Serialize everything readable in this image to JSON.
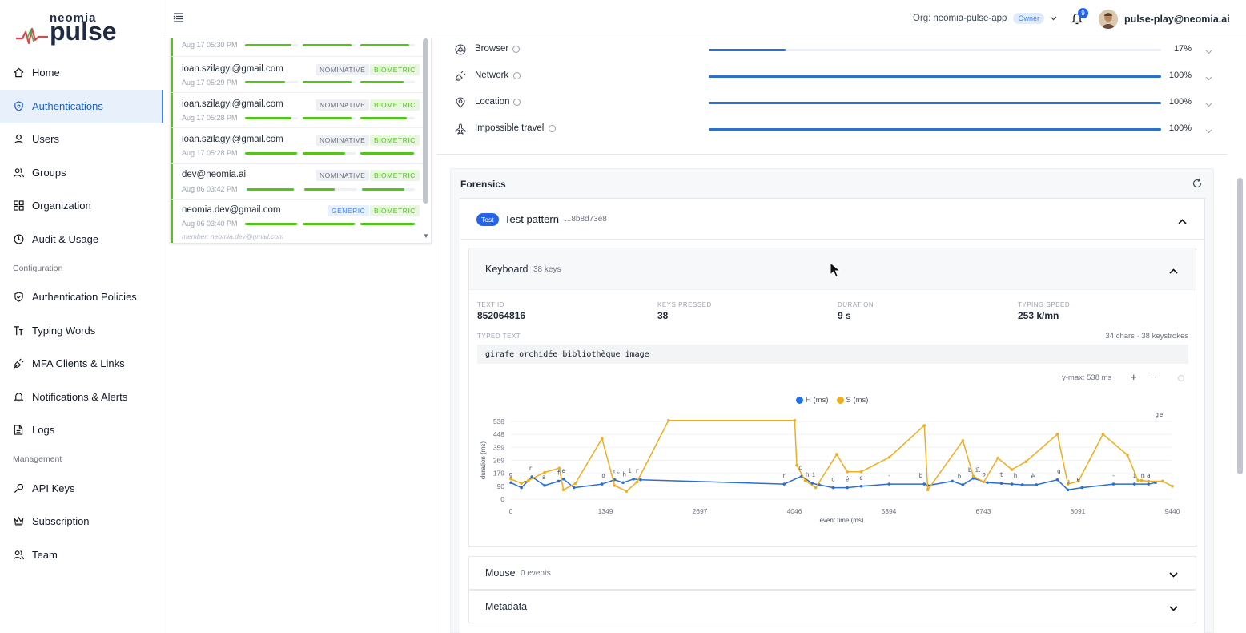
{
  "brand": {
    "small": "neomia",
    "big": "pulse"
  },
  "nav": {
    "items": [
      {
        "label": "Home",
        "icon": "home-icon"
      },
      {
        "label": "Authentications",
        "icon": "shield-icon",
        "active": true
      },
      {
        "label": "Users",
        "icon": "user-icon"
      },
      {
        "label": "Groups",
        "icon": "users-icon"
      },
      {
        "label": "Organization",
        "icon": "grid-icon"
      },
      {
        "label": "Audit & Usage",
        "icon": "clock-icon"
      }
    ],
    "config_heading": "Configuration",
    "config_items": [
      {
        "label": "Authentication Policies",
        "icon": "shield-check-icon"
      },
      {
        "label": "Typing Words",
        "icon": "text-size-icon"
      },
      {
        "label": "MFA Clients & Links",
        "icon": "plug-icon"
      },
      {
        "label": "Notifications & Alerts",
        "icon": "bell-icon"
      },
      {
        "label": "Logs",
        "icon": "file-icon"
      }
    ],
    "mgmt_heading": "Management",
    "mgmt_items": [
      {
        "label": "API Keys",
        "icon": "key-icon"
      },
      {
        "label": "Subscription",
        "icon": "crown-icon"
      },
      {
        "label": "Team",
        "icon": "team-icon"
      }
    ]
  },
  "header": {
    "org_label": "Org:",
    "org_name": "neomia-pulse-app",
    "owner_badge": "Owner",
    "notification_count": "9",
    "user_email": "pulse-play@neomia.ai"
  },
  "auth_list": [
    {
      "email": "",
      "date": "Aug 17 05:30 PM",
      "tags": [],
      "bars": [
        0.88,
        0.93,
        0.9
      ]
    },
    {
      "email": "ioan.szilagyi@gmail.com",
      "date": "Aug 17 05:29 PM",
      "tags": [
        "NOMINATIVE",
        "BIOMETRIC"
      ],
      "bars": [
        0.75,
        0.93,
        0.8
      ]
    },
    {
      "email": "ioan.szilagyi@gmail.com",
      "date": "Aug 17 05:28 PM",
      "tags": [
        "NOMINATIVE",
        "BIOMETRIC"
      ],
      "bars": [
        0.88,
        0.93,
        0.85
      ]
    },
    {
      "email": "ioan.szilagyi@gmail.com",
      "date": "Aug 17 05:28 PM",
      "tags": [
        "NOMINATIVE",
        "BIOMETRIC"
      ],
      "bars": [
        0.98,
        0.8,
        0.98
      ]
    },
    {
      "email": "dev@neomia.ai",
      "date": "Aug 06 03:42 PM",
      "tags": [
        "NOMINATIVE",
        "BIOMETRIC"
      ],
      "bars": [
        0.98,
        0.58,
        0.8
      ]
    },
    {
      "email": "neomia.dev@gmail.com",
      "date": "Aug 06 03:40 PM",
      "tags": [
        "GENERIC",
        "BIOMETRIC"
      ],
      "bars": [
        0.98,
        0.98,
        1.0
      ],
      "member_note": "member: neomia.dev@gmail.com"
    }
  ],
  "signals": [
    {
      "label": "Browser",
      "icon": "browser-icon",
      "value": 17,
      "pct": "17%"
    },
    {
      "label": "Network",
      "icon": "network-icon",
      "value": 100,
      "pct": "100%"
    },
    {
      "label": "Location",
      "icon": "location-icon",
      "value": 100,
      "pct": "100%"
    },
    {
      "label": "Impossible travel",
      "icon": "plane-icon",
      "value": 100,
      "pct": "100%"
    }
  ],
  "forensics": {
    "title": "Forensics",
    "pattern": {
      "badge": "Test",
      "title": "Test pattern",
      "id": "...8b8d73e8"
    },
    "keyboard": {
      "title": "Keyboard",
      "count": "38 keys",
      "stats": [
        {
          "label": "TEXT ID",
          "value": "852064816"
        },
        {
          "label": "KEYS PRESSED",
          "value": "38"
        },
        {
          "label": "DURATION",
          "value": "9 s"
        },
        {
          "label": "TYPING SPEED",
          "value": "253 k/mn"
        }
      ],
      "typed_label": "TYPED TEXT",
      "typed_meta": "34 chars · 38 keystrokes",
      "typed_text": "girafe orchidée bibliothèque image",
      "ymax": "y-max: 538 ms",
      "zoom_plus": "+",
      "zoom_minus": "−"
    },
    "mouse": {
      "title": "Mouse",
      "count": "0 events"
    },
    "metadata": {
      "title": "Metadata"
    }
  },
  "chart_data": {
    "type": "line",
    "xlabel": "event time (ms)",
    "ylabel": "duration (ms)",
    "xlim": [
      0,
      9440
    ],
    "ylim": [
      0,
      538
    ],
    "x_ticks": [
      "0",
      "1349",
      "2697",
      "4046",
      "5394",
      "6743",
      "8091",
      "9440"
    ],
    "y_ticks": [
      "0",
      "90",
      "179",
      "269",
      "359",
      "448",
      "538"
    ],
    "legend": [
      "H (ms)",
      "S (ms)"
    ],
    "colors": {
      "H": "#2b6fd1",
      "S": "#f0ad1e"
    },
    "series": [
      {
        "name": "H (ms)",
        "points": [
          [
            0,
            115
          ],
          [
            150,
            80
          ],
          [
            300,
            155
          ],
          [
            480,
            95
          ],
          [
            680,
            125
          ],
          [
            750,
            140
          ],
          [
            900,
            80
          ],
          [
            1300,
            105
          ],
          [
            1480,
            135
          ],
          [
            1600,
            115
          ],
          [
            1750,
            140
          ],
          [
            1850,
            135
          ],
          [
            3900,
            105
          ],
          [
            4150,
            160
          ],
          [
            4300,
            110
          ],
          [
            4400,
            100
          ],
          [
            4600,
            80
          ],
          [
            4800,
            80
          ],
          [
            5000,
            90
          ],
          [
            5400,
            105
          ],
          [
            5900,
            105
          ],
          [
            5950,
            95
          ],
          [
            6300,
            125
          ],
          [
            6450,
            100
          ],
          [
            6600,
            145
          ],
          [
            6800,
            115
          ],
          [
            7000,
            110
          ],
          [
            7150,
            105
          ],
          [
            7300,
            100
          ],
          [
            7500,
            100
          ],
          [
            7800,
            135
          ],
          [
            7950,
            65
          ],
          [
            8150,
            80
          ],
          [
            8600,
            105
          ],
          [
            8900,
            105
          ],
          [
            9100,
            105
          ],
          [
            9200,
            115
          ]
        ]
      },
      {
        "name": "S (ms)",
        "points": [
          [
            0,
            140
          ],
          [
            150,
            110
          ],
          [
            250,
            130
          ],
          [
            480,
            185
          ],
          [
            690,
            215
          ],
          [
            750,
            65
          ],
          [
            920,
            110
          ],
          [
            1300,
            420
          ],
          [
            1480,
            95
          ],
          [
            1650,
            55
          ],
          [
            1800,
            120
          ],
          [
            2250,
            545
          ],
          [
            4050,
            545
          ],
          [
            4080,
            235
          ],
          [
            4200,
            130
          ],
          [
            4350,
            80
          ],
          [
            4650,
            310
          ],
          [
            4800,
            190
          ],
          [
            5000,
            190
          ],
          [
            5400,
            290
          ],
          [
            5900,
            510
          ],
          [
            5950,
            65
          ],
          [
            6450,
            405
          ],
          [
            6600,
            160
          ],
          [
            6750,
            120
          ],
          [
            6950,
            285
          ],
          [
            7150,
            205
          ],
          [
            7350,
            260
          ],
          [
            7800,
            450
          ],
          [
            7950,
            105
          ],
          [
            8100,
            125
          ],
          [
            8450,
            450
          ],
          [
            8800,
            305
          ],
          [
            8950,
            130
          ],
          [
            9000,
            130
          ],
          [
            9100,
            125
          ],
          [
            9300,
            125
          ],
          [
            9440,
            90
          ]
        ]
      }
    ],
    "key_labels": [
      [
        "g",
        0
      ],
      [
        "i",
        200
      ],
      [
        "r",
        280
      ],
      [
        "a",
        470
      ],
      [
        "f",
        680
      ],
      [
        "e",
        750
      ],
      [
        "o",
        1320
      ],
      [
        "r",
        1480
      ],
      [
        "c",
        1530
      ],
      [
        "h",
        1620
      ],
      [
        "i",
        1700
      ],
      [
        "r",
        1800
      ],
      [
        "r",
        3900
      ],
      [
        "c",
        4130
      ],
      [
        "h",
        4230
      ],
      [
        "i",
        4320
      ],
      [
        "d",
        4600
      ],
      [
        "é",
        4800
      ],
      [
        "e",
        5000
      ],
      [
        "-",
        5400
      ],
      [
        "b",
        5850
      ],
      [
        "b",
        6400
      ],
      [
        "i",
        6650
      ],
      [
        "b",
        6550
      ],
      [
        "l",
        6680
      ],
      [
        "o",
        6750
      ],
      [
        "t",
        7000
      ],
      [
        "h",
        7200
      ],
      [
        "è",
        7450
      ],
      [
        "q",
        7820
      ],
      [
        "u",
        7950
      ],
      [
        "e",
        8100
      ],
      [
        "-",
        8600
      ],
      [
        "i",
        8900
      ],
      [
        "m",
        9020
      ],
      [
        "a",
        9100
      ],
      [
        "g",
        9220
      ],
      [
        "e",
        9280
      ]
    ]
  }
}
